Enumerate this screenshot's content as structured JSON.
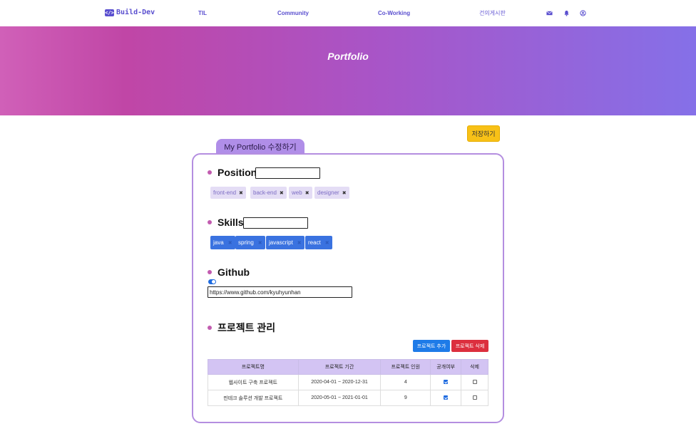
{
  "nav": {
    "logo_text": "Build-Dev",
    "links": [
      "TIL",
      "Community",
      "Co-Working",
      "건의게시판"
    ],
    "icons": [
      "mail-icon",
      "bell-icon",
      "user-icon"
    ]
  },
  "hero": {
    "title": "Portfolio"
  },
  "save_label": "저장하기",
  "card": {
    "tab_label": "My Portfolio 수정하기",
    "position": {
      "heading": "Position",
      "input_value": "",
      "tags": [
        "front-end",
        "back-end",
        "web",
        "designer"
      ]
    },
    "skills": {
      "heading": "Skills",
      "input_value": "",
      "tags": [
        "java",
        "spring",
        "javascript",
        "react"
      ]
    },
    "github": {
      "heading": "Github",
      "toggle_on": true,
      "url": "https://www.github.com/kyuhyunhan"
    },
    "projects": {
      "heading": "프로젝트 관리",
      "add_label": "프로젝트 추가",
      "delete_label": "프로젝트 삭제",
      "columns": [
        "프로젝트명",
        "프로젝트 기간",
        "프로젝트 인원",
        "공개여부",
        "삭제"
      ],
      "rows": [
        {
          "name": "웹사이트 구축 프로젝트",
          "period": "2020-04-01 ~ 2020-12-31",
          "members": "4",
          "public": true,
          "delete": false
        },
        {
          "name": "핀테크 솔루션 개발 프로젝트",
          "period": "2020-05-01 ~ 2021-01-01",
          "members": "9",
          "public": true,
          "delete": false
        }
      ]
    }
  },
  "colors": {
    "accent": "#5a4fcf",
    "hero_start": "#d060b8",
    "hero_end": "#8570e8",
    "save": "#f8c117",
    "skill": "#3a72e0",
    "add": "#1e7be8",
    "delete": "#dc2f3e"
  }
}
